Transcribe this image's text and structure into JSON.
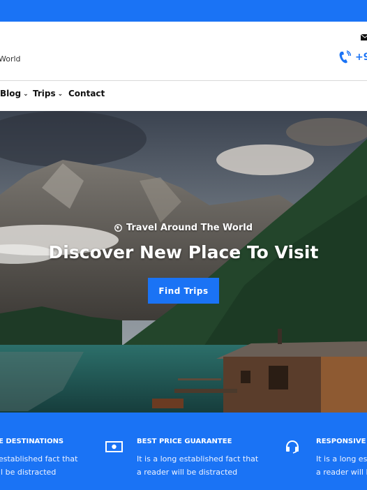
{
  "header": {
    "tagline": "World",
    "phone": "+9"
  },
  "nav": {
    "items": [
      {
        "label": "Blog",
        "dropdown": true
      },
      {
        "label": "Trips",
        "dropdown": true
      },
      {
        "label": "Contact",
        "dropdown": false
      }
    ]
  },
  "hero": {
    "subtitle": "Travel Around The World",
    "title": "Discover New Place To Visit",
    "button_label": "Find Trips"
  },
  "features": [
    {
      "title": "E DESTINATIONS",
      "line1": "established fact that",
      "line2": "ll be distracted",
      "icon": "globe-icon"
    },
    {
      "title": "BEST PRICE GUARANTEE",
      "line1": "It is a long established fact that",
      "line2": "a reader will be distracted",
      "icon": "money-icon"
    },
    {
      "title": "RESPONSIVE S",
      "line1": "It is a long es",
      "line2": "a reader will b",
      "icon": "headset-icon"
    }
  ],
  "colors": {
    "accent": "#1a73f5",
    "white": "#ffffff"
  }
}
